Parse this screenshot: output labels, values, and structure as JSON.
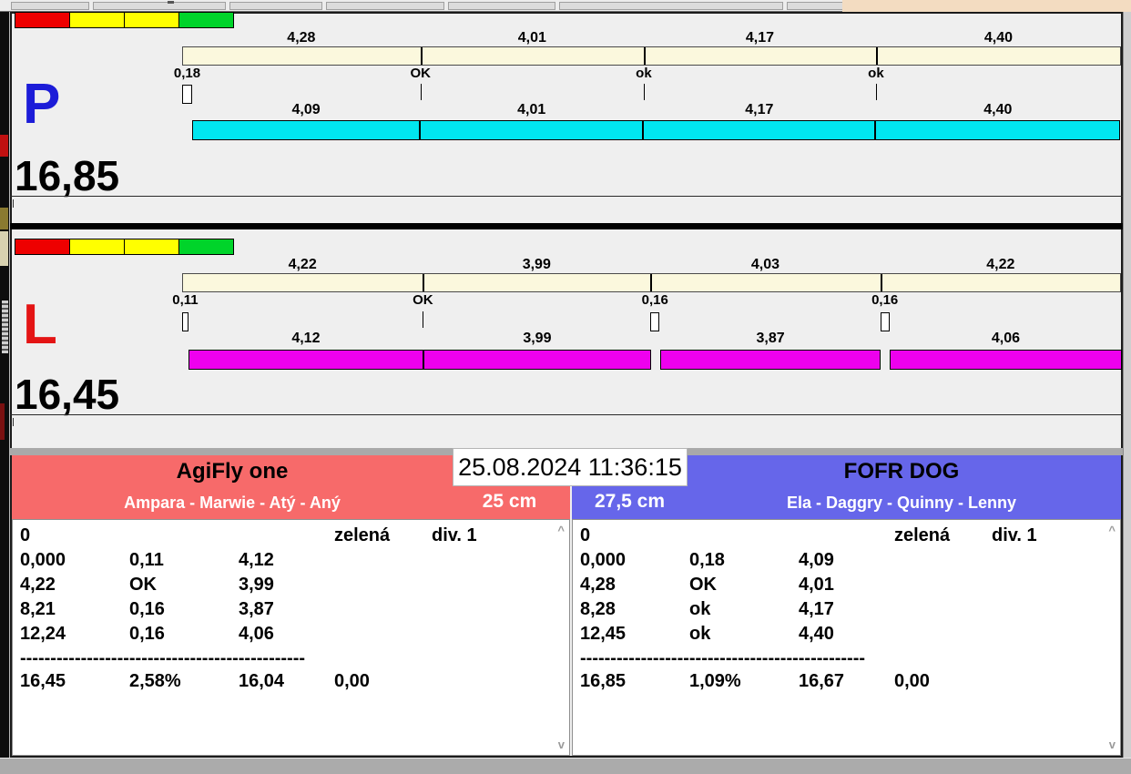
{
  "window": {
    "datetime": "25.08.2024 11:36:15"
  },
  "start_lights": [
    "#ee0000",
    "#ffff00",
    "#ffff00",
    "#00d42a"
  ],
  "lanes": [
    {
      "letter": "P",
      "letter_color": "#1c1cd8",
      "total": "16,85",
      "bottom_color": "#00e6f0",
      "top_segments": [
        {
          "label": "4,28",
          "value": 4.28
        },
        {
          "label": "4,01",
          "value": 4.01
        },
        {
          "label": "4,17",
          "value": 4.17
        },
        {
          "label": "4,40",
          "value": 4.4
        }
      ],
      "exchanges": [
        {
          "label": "0,18",
          "loss": 0.18
        },
        {
          "label": "OK",
          "loss": 0
        },
        {
          "label": "ok",
          "loss": 0
        },
        {
          "label": "ok",
          "loss": 0
        }
      ],
      "bottom_segments": [
        {
          "label": "4,09",
          "value": 4.09
        },
        {
          "label": "4,01",
          "value": 4.01
        },
        {
          "label": "4,17",
          "value": 4.17
        },
        {
          "label": "4,40",
          "value": 4.4
        }
      ]
    },
    {
      "letter": "L",
      "letter_color": "#e41414",
      "total": "16,45",
      "bottom_color": "#ee00ee",
      "top_segments": [
        {
          "label": "4,22",
          "value": 4.22
        },
        {
          "label": "3,99",
          "value": 3.99
        },
        {
          "label": "4,03",
          "value": 4.03
        },
        {
          "label": "4,22",
          "value": 4.22
        }
      ],
      "exchanges": [
        {
          "label": "0,11",
          "loss": 0.11
        },
        {
          "label": "OK",
          "loss": 0
        },
        {
          "label": "0,16",
          "loss": 0.16
        },
        {
          "label": "0,16",
          "loss": 0.16
        }
      ],
      "bottom_segments": [
        {
          "label": "4,12",
          "value": 4.12
        },
        {
          "label": "3,99",
          "value": 3.99
        },
        {
          "label": "3,87",
          "value": 3.87
        },
        {
          "label": "4,06",
          "value": 4.06
        }
      ]
    }
  ],
  "teams": [
    {
      "name": "AgiFly one",
      "members": "Ampara - Marwie - Atý - Aný",
      "jump_height": "25 cm",
      "color": "#f76a6a",
      "result": {
        "rows": [
          [
            "0",
            "",
            "",
            "zelená",
            "div. 1"
          ],
          [
            "0,000",
            "0,11",
            "4,12",
            "",
            ""
          ],
          [
            "4,22",
            "OK",
            "3,99",
            "",
            ""
          ],
          [
            "8,21",
            "0,16",
            "3,87",
            "",
            ""
          ],
          [
            "12,24",
            "0,16",
            "4,06",
            "",
            ""
          ]
        ],
        "separator": "-----------------------------------------------",
        "summary": [
          "16,45",
          "2,58%",
          "16,04",
          "0,00",
          ""
        ]
      }
    },
    {
      "name": "FOFR DOG",
      "members": "Ela - Daggry - Quinny - Lenny",
      "jump_height": "27,5 cm",
      "color": "#6666ea",
      "result": {
        "rows": [
          [
            "0",
            "",
            "",
            "zelená",
            "div. 1"
          ],
          [
            "0,000",
            "0,18",
            "4,09",
            "",
            ""
          ],
          [
            "4,28",
            "OK",
            "4,01",
            "",
            ""
          ],
          [
            "8,28",
            "ok",
            "4,17",
            "",
            ""
          ],
          [
            "12,45",
            "ok",
            "4,40",
            "",
            ""
          ]
        ],
        "separator": "-----------------------------------------------",
        "summary": [
          "16,85",
          "1,09%",
          "16,67",
          "0,00",
          ""
        ]
      }
    }
  ]
}
